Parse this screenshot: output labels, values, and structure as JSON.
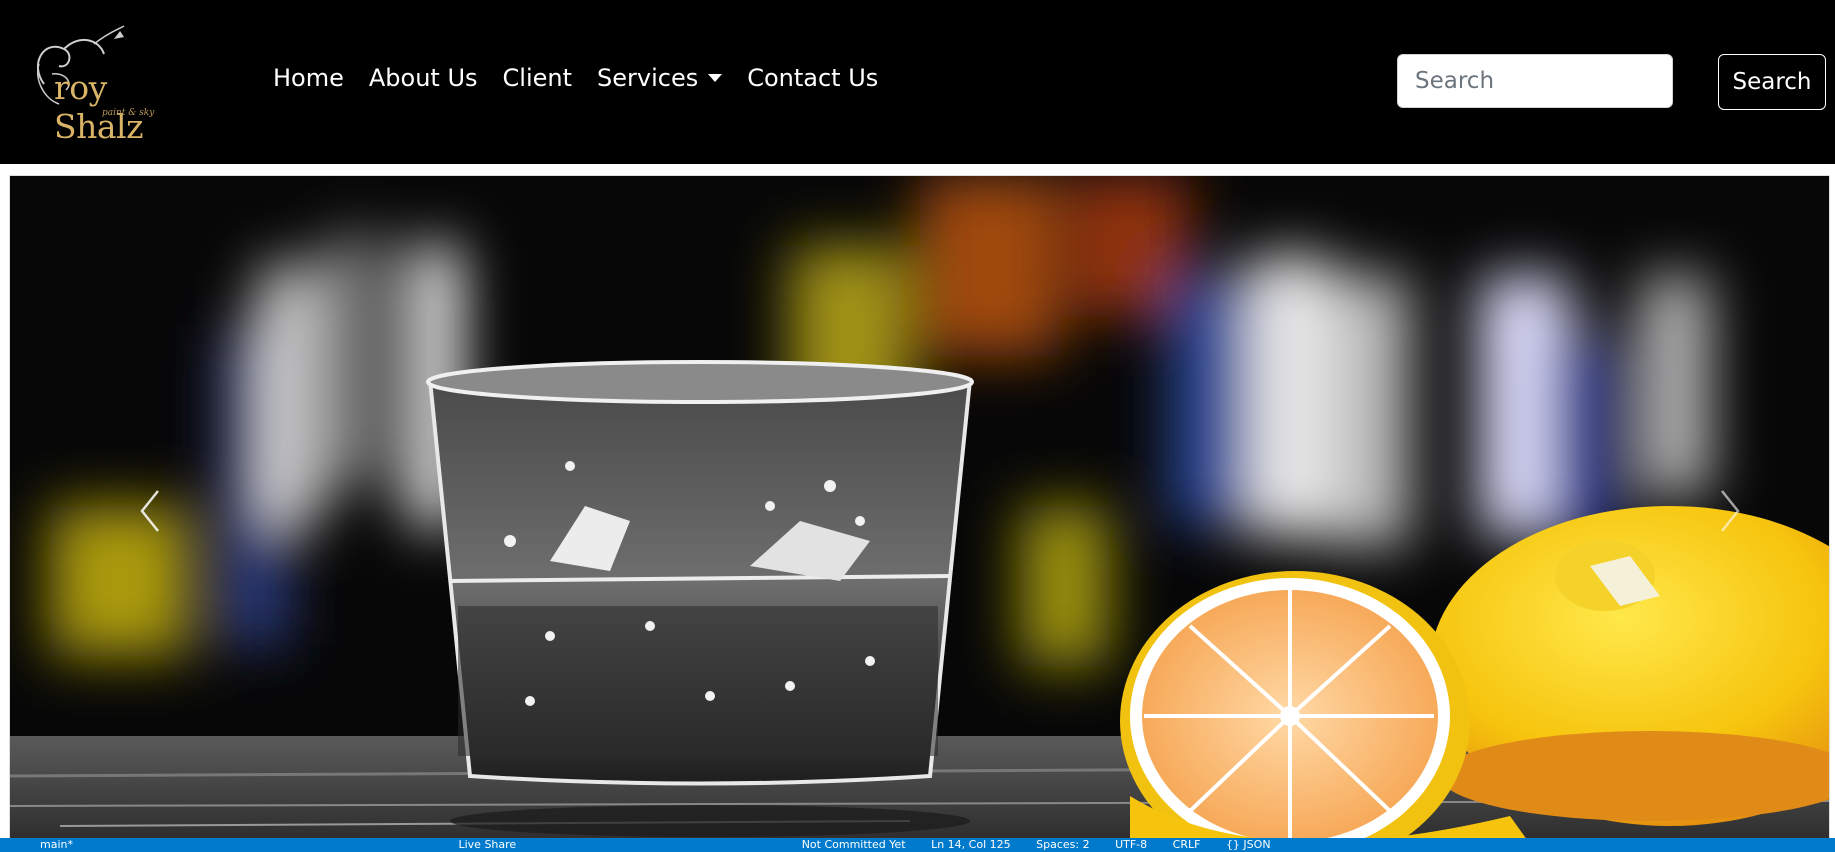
{
  "brand": {
    "name": "roy Shalz",
    "tagline": "paint & sky"
  },
  "nav": {
    "items": [
      "Home",
      "About Us",
      "Client"
    ],
    "services_label": "Services",
    "contact_label": "Contact Us"
  },
  "search": {
    "placeholder": "Search",
    "button_label": "Search"
  },
  "carousel": {
    "slide": "glass-with-ice-and-lemons",
    "prev_icon": "chevron-left-icon",
    "next_icon": "chevron-right-icon"
  },
  "statusbar": {
    "items": [
      "main*",
      "Live Share",
      "Not Committed Yet",
      "Ln 14, Col 125",
      "Spaces: 2",
      "UTF-8",
      "CRLF",
      "{} JSON"
    ]
  }
}
